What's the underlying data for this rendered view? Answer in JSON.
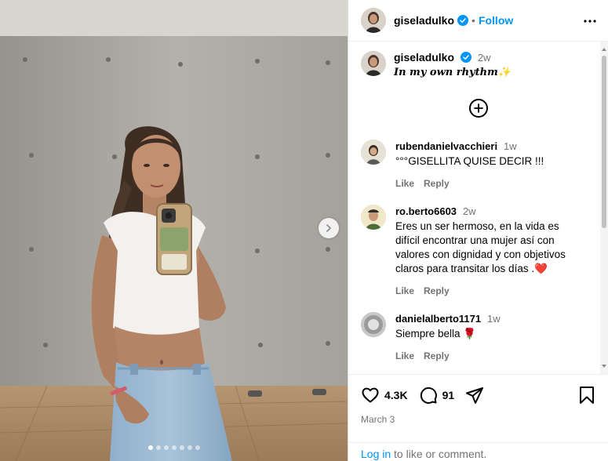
{
  "post": {
    "author": "giseladulko",
    "follow_label": "Follow",
    "dot_separator": "•",
    "caption_time": "2w",
    "caption_text": "In my own rhythm✨",
    "likes": "4.3K",
    "comments_count": "91",
    "date": "March 3",
    "carousel": {
      "slides": 7,
      "active": 0
    }
  },
  "comments": [
    {
      "user": "rubendanielvacchieri",
      "time": "1w",
      "text": "°°°GISELLITA QUISE DECIR !!!",
      "like_label": "Like",
      "reply_label": "Reply"
    },
    {
      "user": "ro.berto6603",
      "time": "2w",
      "text": "Eres un ser hermoso, en la vida es difícil encontrar una mujer así con valores con dignidad y con objetivos claros para transitar los días .❤️",
      "like_label": "Like",
      "reply_label": "Reply"
    },
    {
      "user": "danielalberto1171",
      "time": "1w",
      "text": "Siempre bella 🌹",
      "like_label": "Like",
      "reply_label": "Reply"
    }
  ],
  "footer": {
    "login_link": "Log in",
    "login_suffix": " to like or comment."
  },
  "icons": {
    "verified": "verified-badge-icon",
    "more": "more-options-icon",
    "add_comment": "plus-circle-icon",
    "like": "heart-icon",
    "comment": "comment-bubble-icon",
    "share": "paper-plane-icon",
    "save": "bookmark-icon",
    "next": "chevron-right-icon"
  },
  "colors": {
    "accent": "#0095f6",
    "muted": "#737373",
    "border": "#dbdbdb"
  }
}
